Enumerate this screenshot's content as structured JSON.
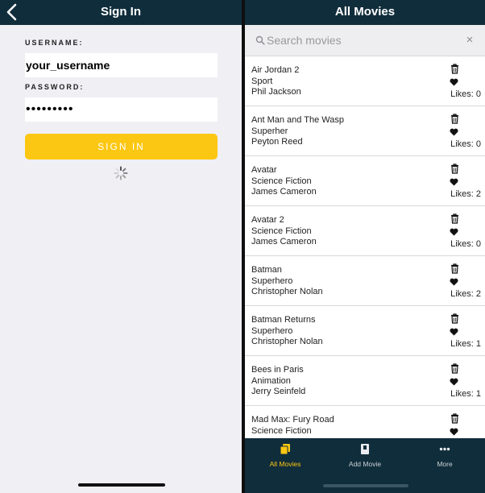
{
  "sign_in": {
    "title": "Sign In",
    "username_label": "USERNAME:",
    "username_value": "your_username",
    "password_label": "PASSWORD:",
    "password_value": "•••••••••",
    "submit_label": "SIGN IN"
  },
  "movies": {
    "title": "All Movies",
    "search_placeholder": "Search movies",
    "clear_label": "×",
    "items": [
      {
        "title": "Air Jordan 2",
        "genre": "Sport",
        "director": "Phil Jackson",
        "likes": "Likes: 0"
      },
      {
        "title": "Ant Man and The Wasp",
        "genre": "Superher",
        "director": "Peyton Reed",
        "likes": "Likes: 0"
      },
      {
        "title": "Avatar",
        "genre": "Science Fiction",
        "director": "James Cameron",
        "likes": "Likes: 2"
      },
      {
        "title": "Avatar 2",
        "genre": "Science Fiction",
        "director": "James Cameron",
        "likes": "Likes: 0"
      },
      {
        "title": "Batman",
        "genre": "Superhero",
        "director": "Christopher Nolan",
        "likes": "Likes: 2"
      },
      {
        "title": "Batman Returns",
        "genre": "Superhero",
        "director": "Christopher Nolan",
        "likes": "Likes: 1"
      },
      {
        "title": "Bees in Paris",
        "genre": "Animation",
        "director": "Jerry Seinfeld",
        "likes": "Likes: 1"
      },
      {
        "title": "Mad Max: Fury Road",
        "genre": "Science Fiction",
        "director": "",
        "likes": ""
      }
    ],
    "tabs": [
      {
        "label": "All Movies",
        "icon": "film-icon"
      },
      {
        "label": "Add Movie",
        "icon": "add-movie-icon"
      },
      {
        "label": "More",
        "icon": "more-icon"
      }
    ]
  },
  "colors": {
    "navbar": "#102d3b",
    "accent": "#fcc712",
    "background": "#efeff4"
  }
}
